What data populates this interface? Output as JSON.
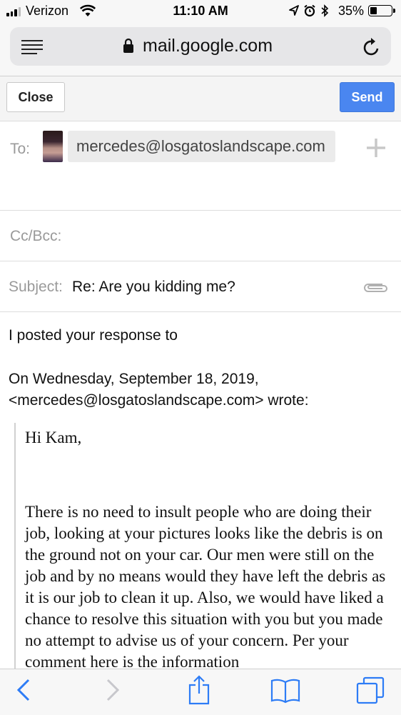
{
  "status_bar": {
    "carrier": "Verizon",
    "time": "11:10 AM",
    "battery": "35%",
    "battery_level": 0.35
  },
  "browser": {
    "url": "mail.google.com"
  },
  "toolbar": {
    "close_label": "Close",
    "send_label": "Send",
    "send_color": "#4a86f0"
  },
  "compose": {
    "to_label": "To:",
    "to_recipient": "mercedes@losgatoslandscape.com",
    "cc_label": "Cc/Bcc:",
    "subject_label": "Subject:",
    "subject": "Re: Are you kidding me?",
    "body_line": "I posted your response to",
    "wrote_line": "On Wednesday, September 18, 2019, <mercedes@losgatoslandscape.com> wrote:",
    "quoted_greeting": "Hi Kam,",
    "quoted_paragraph": "There is no need to insult people who are doing their job, looking at your pictures looks like the debris is on the ground not on your car. Our men were still on the job and by no means would they have left the debris as it is our job to clean it up. Also, we would have liked a chance to resolve this situation with you but you made no attempt to advise us of your concern. Per your comment here is the information"
  },
  "icons": [
    "signal-icon",
    "wifi-icon",
    "location-icon",
    "alarm-icon",
    "bluetooth-icon",
    "battery-icon",
    "menu-icon",
    "lock-icon",
    "reload-icon",
    "plus-icon",
    "paperclip-icon",
    "back-icon",
    "forward-icon",
    "share-icon",
    "bookmarks-icon",
    "tabs-icon"
  ],
  "accent_color": "#1a73e8"
}
